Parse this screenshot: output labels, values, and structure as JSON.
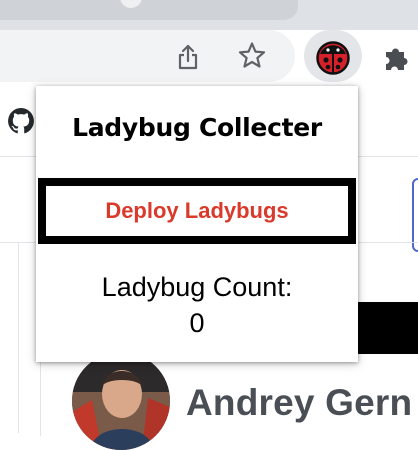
{
  "colors": {
    "accent_red": "#d93a2b",
    "chrome_bg": "#dee1e6",
    "omnibox_bg": "#f1f3f4"
  },
  "toolbar": {
    "icons": [
      "share-icon",
      "star-icon",
      "ladybug-extension-icon",
      "puzzle-extensions-icon"
    ]
  },
  "popup": {
    "title": "Ladybug Collecter",
    "deploy_button_label": "Deploy Ladybugs",
    "count_label": "Ladybug Count:",
    "count_value": "0"
  },
  "page": {
    "profile_name": "Andrey Gern",
    "side_fragment": "n",
    "icons": [
      "github-icon"
    ]
  }
}
